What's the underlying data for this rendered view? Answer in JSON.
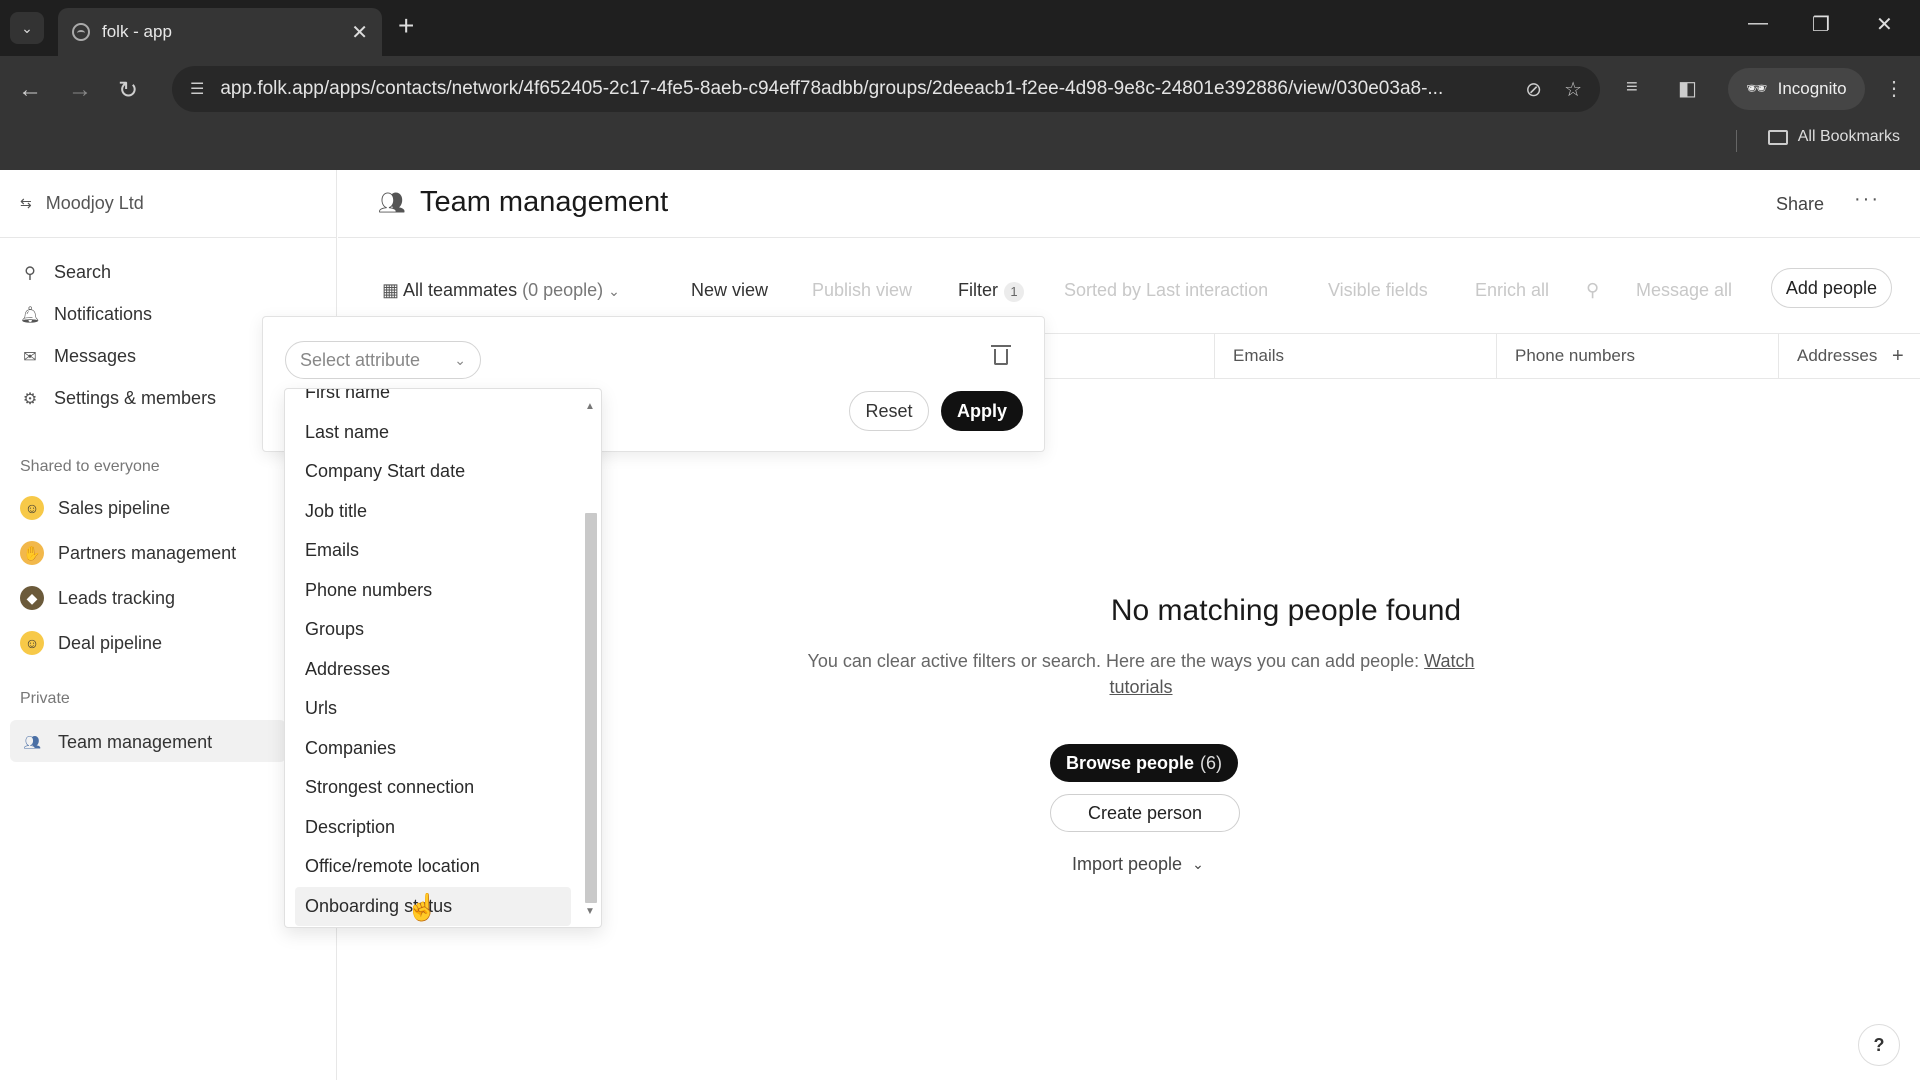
{
  "browser": {
    "tab_title": "folk - app",
    "url": "app.folk.app/apps/contacts/network/4f652405-2c17-4fe5-8aeb-c94eff78adbb/groups/2deeacb1-f2ee-4d98-9e8c-24801e392886/view/030e03a8-...",
    "incognito_label": "Incognito",
    "bookmarks_label": "All Bookmarks"
  },
  "sidebar": {
    "workspace": "Moodjoy Ltd",
    "nav": [
      {
        "label": "Search",
        "icon": "search-icon"
      },
      {
        "label": "Notifications",
        "icon": "bell-icon"
      },
      {
        "label": "Messages",
        "icon": "mail-icon"
      },
      {
        "label": "Settings & members",
        "icon": "gear-icon"
      }
    ],
    "shared_label": "Shared to everyone",
    "shared": [
      {
        "label": "Sales pipeline",
        "icon": "grinning-face-icon"
      },
      {
        "label": "Partners management",
        "icon": "handshake-icon"
      },
      {
        "label": "Leads tracking",
        "icon": "detective-icon"
      },
      {
        "label": "Deal pipeline",
        "icon": "smiley-icon"
      }
    ],
    "private_label": "Private",
    "private": [
      {
        "label": "Team management",
        "icon": "people-icon"
      }
    ]
  },
  "header": {
    "title": "Team management",
    "share_label": "Share",
    "more_label": "···"
  },
  "viewbar": {
    "view_name": "All teammates",
    "view_count": "(0 people)",
    "new_view": "New view",
    "publish_view": "Publish view",
    "filter": "Filter",
    "filter_count": "1",
    "sorted": "Sorted by Last interaction",
    "visible_fields": "Visible fields",
    "enrich_all": "Enrich all",
    "message_all": "Message all",
    "add_people": "Add people"
  },
  "columns": [
    "Emails",
    "Phone numbers",
    "Addresses"
  ],
  "empty_state": {
    "title": "No matching people found",
    "subtitle": "You can clear active filters or search. Here are the ways you can add people:",
    "link": "Watch tutorials",
    "browse": "Browse people",
    "browse_count": "(6)",
    "create": "Create person",
    "import": "Import people"
  },
  "filter": {
    "select_placeholder": "Select attribute",
    "reset": "Reset",
    "apply": "Apply"
  },
  "dropdown": {
    "items": [
      "First name",
      "Last name",
      "Company Start date",
      "Job title",
      "Emails",
      "Phone numbers",
      "Groups",
      "Addresses",
      "Urls",
      "Companies",
      "Strongest connection",
      "Description",
      "Office/remote location",
      "Onboarding status"
    ],
    "hovered": "Onboarding status"
  },
  "help_label": "?"
}
